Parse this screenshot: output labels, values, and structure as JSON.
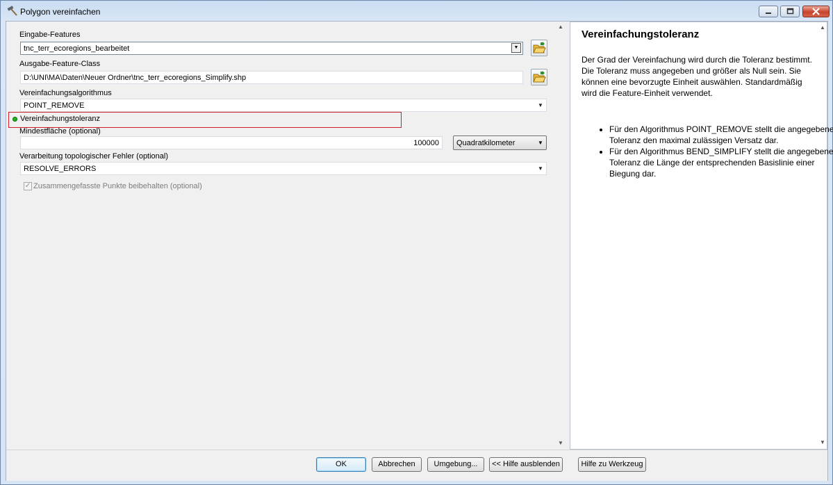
{
  "window": {
    "title": "Polygon vereinfachen"
  },
  "icons": {
    "title": "hammer-icon",
    "browse": "open-folder-icon",
    "minimize": "minimize-icon",
    "maximize": "maximize-icon",
    "close": "close-icon"
  },
  "colors": {
    "required_dot": "#1fb51f",
    "highlight_border": "#d01f2a",
    "close_button": "#c8452c"
  },
  "form": {
    "input_features": {
      "label": "Eingabe-Features",
      "value": "tnc_terr_ecoregions_bearbeitet"
    },
    "output_feature_class": {
      "label": "Ausgabe-Feature-Class",
      "value": "D:\\UNI\\MA\\Daten\\Neuer Ordner\\tnc_terr_ecoregions_Simplify.shp"
    },
    "algorithm": {
      "label": "Vereinfachungsalgorithmus",
      "value": "POINT_REMOVE"
    },
    "tolerance": {
      "label": "Vereinfachungstoleranz"
    },
    "min_area": {
      "label": "Mindestfläche (optional)",
      "value": "100000",
      "unit": "Quadratkilometer"
    },
    "topology_errors": {
      "label": "Verarbeitung topologischer Fehler (optional)",
      "value": "RESOLVE_ERRORS"
    },
    "keep_points": {
      "label": "Zusammengefasste Punkte beibehalten (optional)",
      "checked": true,
      "mark": "✓"
    }
  },
  "help": {
    "title": "Vereinfachungstoleranz",
    "paragraph": "Der Grad der Vereinfachung wird durch die Toleranz bestimmt. Die Toleranz muss angegeben und größer als Null sein. Sie können eine bevorzugte Einheit auswählen. Standardmäßig wird die Feature-Einheit verwendet.",
    "bullets": [
      "Für den Algorithmus POINT_REMOVE stellt die angegebene Toleranz den maximal zulässigen Versatz dar.",
      "Für den Algorithmus BEND_SIMPLIFY stellt die angegebene Toleranz die Länge der entsprechenden Basislinie einer Biegung dar."
    ]
  },
  "buttons": {
    "ok": "OK",
    "cancel": "Abbrechen",
    "environments": "Umgebung...",
    "hide_help": "<< Hilfe ausblenden",
    "tool_help": "Hilfe zu Werkzeug"
  }
}
